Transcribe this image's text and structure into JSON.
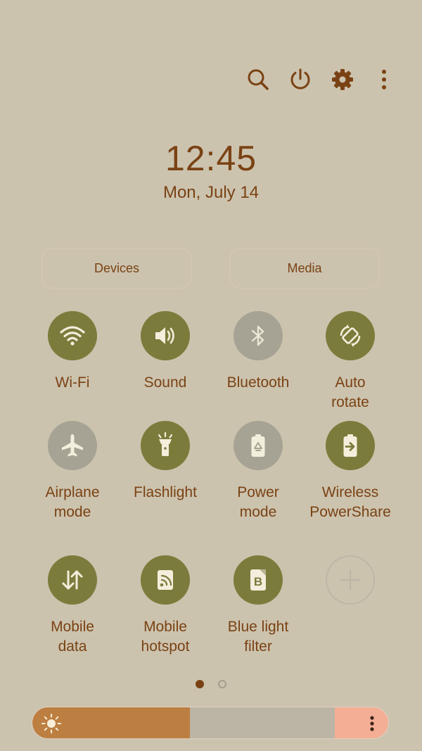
{
  "header": {
    "icons": [
      "search-icon",
      "power-icon",
      "gear-icon",
      "more-vert-icon"
    ]
  },
  "clock": {
    "time": "12:45",
    "date": "Mon, July 14"
  },
  "buttons": {
    "devices": "Devices",
    "media": "Media"
  },
  "tiles": [
    {
      "label": "Wi-Fi",
      "icon": "wifi-icon",
      "state": "on"
    },
    {
      "label": "Sound",
      "icon": "sound-icon",
      "state": "on"
    },
    {
      "label": "Bluetooth",
      "icon": "bluetooth-icon",
      "state": "off"
    },
    {
      "label": "Auto\nrotate",
      "icon": "auto-rotate-icon",
      "state": "on"
    },
    {
      "label": "Airplane\nmode",
      "icon": "airplane-icon",
      "state": "off"
    },
    {
      "label": "Flashlight",
      "icon": "flashlight-icon",
      "state": "on"
    },
    {
      "label": "Power\nmode",
      "icon": "power-mode-icon",
      "state": "off"
    },
    {
      "label": "Wireless\nPowerShare",
      "icon": "wireless-powershare-icon",
      "state": "on"
    },
    {
      "label": "Mobile\ndata",
      "icon": "mobile-data-icon",
      "state": "on"
    },
    {
      "label": "Mobile\nhotspot",
      "icon": "hotspot-icon",
      "state": "on"
    },
    {
      "label": "Blue light\nfilter",
      "icon": "blue-light-filter-icon",
      "state": "on"
    },
    {
      "label": "",
      "icon": "add-icon",
      "state": "add"
    }
  ],
  "pager": {
    "current": 1,
    "total": 2
  },
  "brightness": {
    "level": 0.44
  },
  "colors": {
    "background": "#CCC3AE",
    "accent_text": "#7A4214",
    "tile_on": "#7B7C3C",
    "tile_off": "#A6A394",
    "brightness_fill": "#BD7F41",
    "brightness_track": "#BCB5A5",
    "brightness_end": "#F3AE95"
  }
}
